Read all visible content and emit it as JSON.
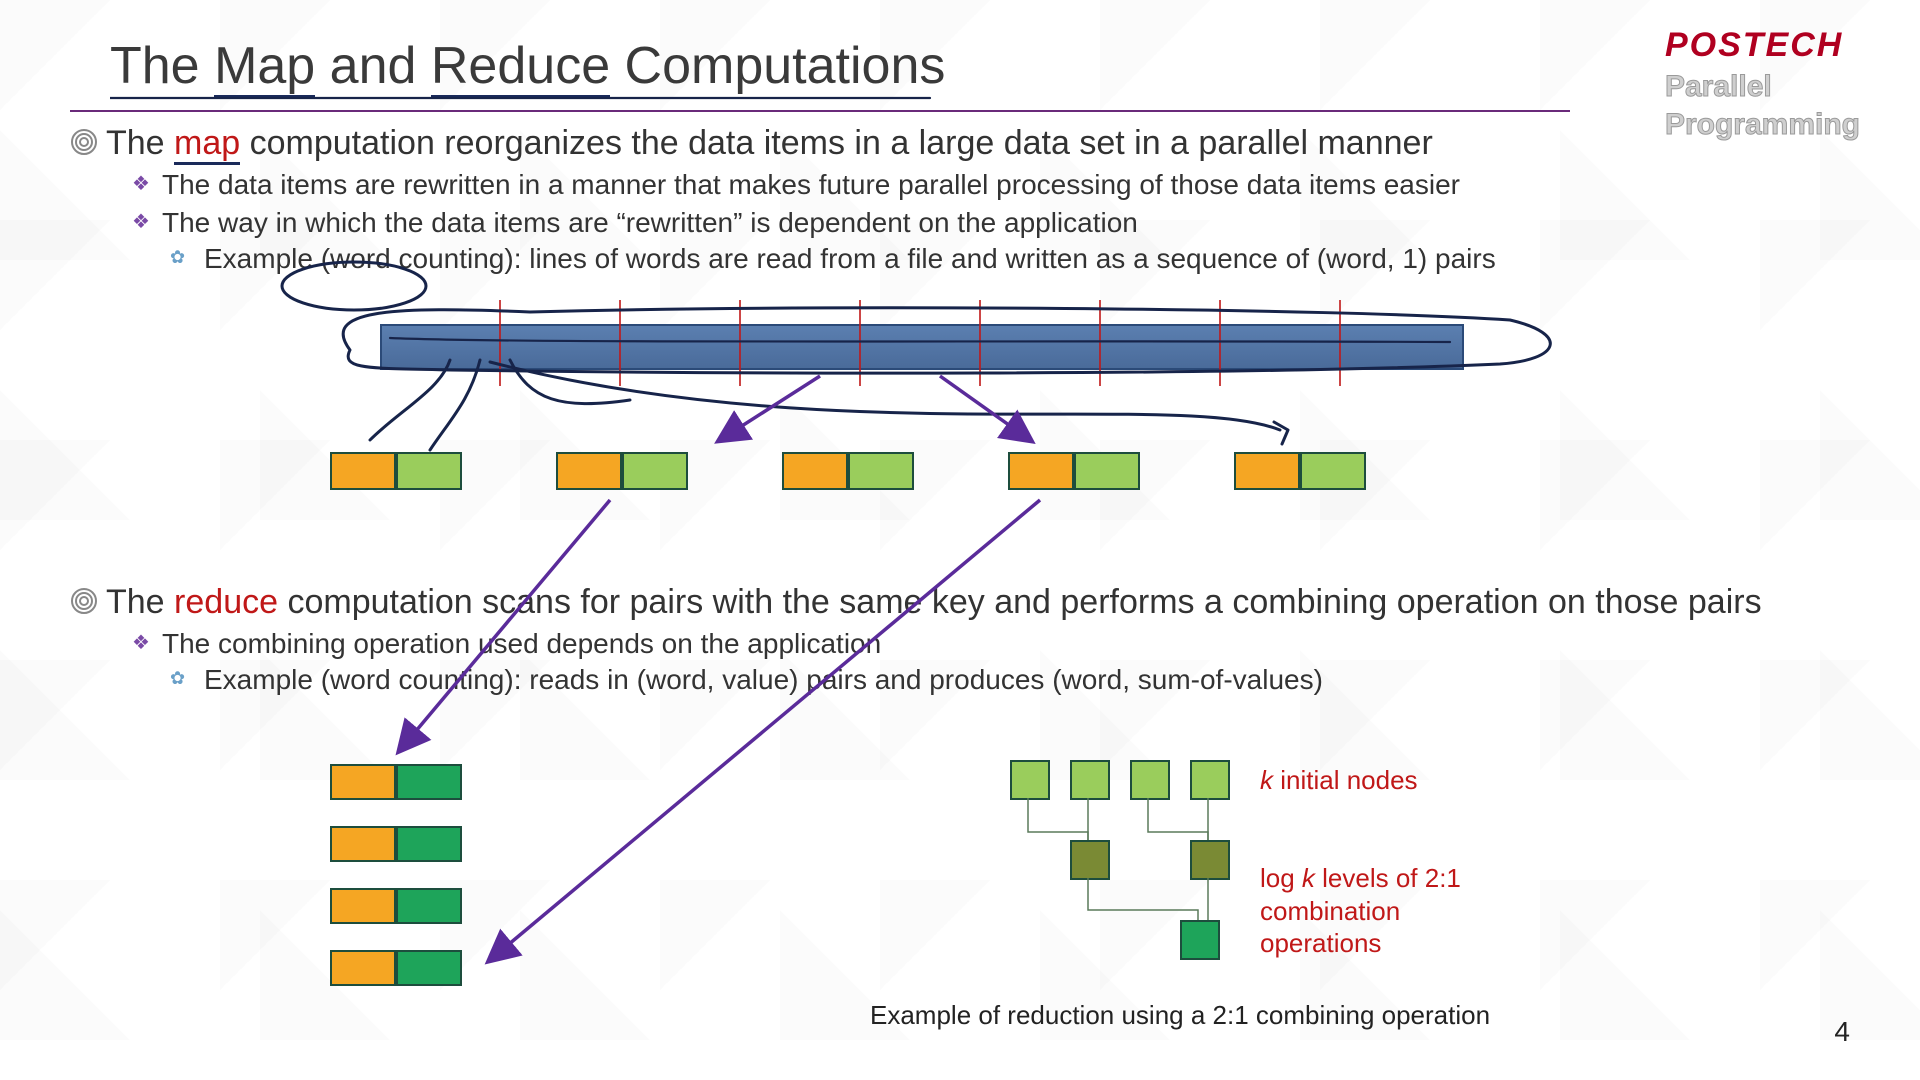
{
  "title": {
    "pre": "The ",
    "w1": "Map",
    "mid": " and ",
    "w2": "Reduce",
    "post": " Computations"
  },
  "logo": {
    "brand": "POSTECH",
    "line1": "Parallel",
    "line2": "Programming"
  },
  "map": {
    "heading_pre": "The ",
    "heading_hl": "map",
    "heading_post": " computation reorganizes the data items in a large data set in a parallel manner",
    "b1": "The data items are rewritten in a manner that makes future parallel processing of those data items easier",
    "b2": "The way in which the data items are “rewritten” is dependent on the application",
    "ex": "Example (word counting): lines of words are read from a file and written as a sequence of (word, 1) pairs"
  },
  "reduce": {
    "heading_pre": "The ",
    "heading_hl": "reduce",
    "heading_post": " computation scans for pairs with the same key and performs a combining operation on those pairs",
    "b1": "The combining operation used depends on the application",
    "ex": "Example (word counting): reads in (word, value) pairs and produces (word, sum-of-values)"
  },
  "tree": {
    "label1_i": "k",
    "label1_rest": " initial nodes",
    "label2_pre": "log ",
    "label2_i": "k",
    "label2_rest": " levels of 2:1 combination operations"
  },
  "caption": "Example of reduction using a 2:1 combining operation",
  "page": "4"
}
